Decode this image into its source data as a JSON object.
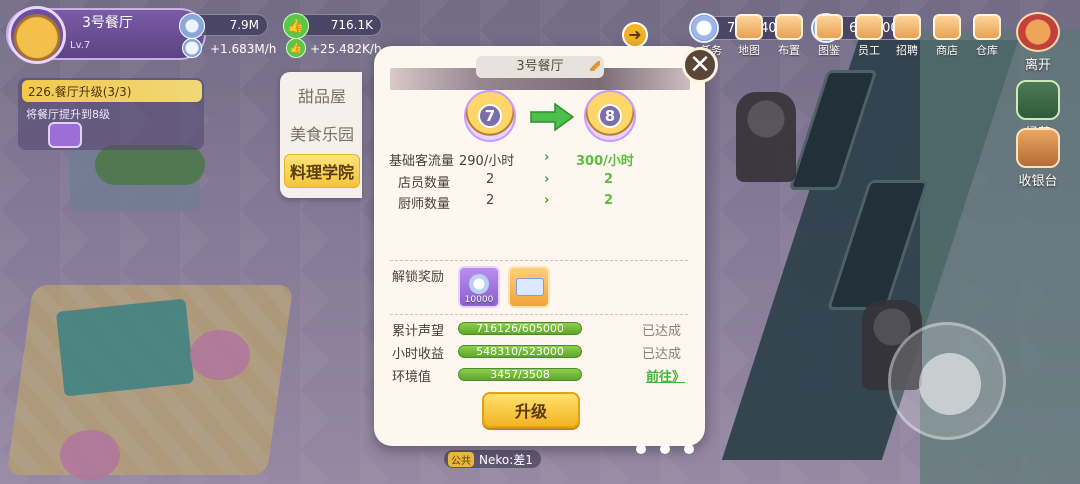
{
  "restaurant": {
    "name": "3号餐厅",
    "level": "Lv.7"
  },
  "resources": {
    "coins": "7.9M",
    "likes": "716.1K",
    "coin_rate": "+1.683M/h",
    "like_rate": "+25.482K/h"
  },
  "task": {
    "title": "226.餐厅升级(3/3)",
    "desc": "将餐厅提升到8级"
  },
  "currencies": [
    {
      "value": "7900402"
    },
    {
      "value": "659500"
    }
  ],
  "top_menu": [
    "任务",
    "地图",
    "布置",
    "图鉴",
    "员工",
    "招聘",
    "商店",
    "仓库"
  ],
  "side_buttons": {
    "leave": "离开",
    "manage": "经营",
    "cashier": "收银台"
  },
  "tabs": [
    {
      "label": "甜品屋",
      "active": false
    },
    {
      "label": "美食乐园",
      "active": false
    },
    {
      "label": "料理学院",
      "active": true
    }
  ],
  "dialog": {
    "title": "3号餐厅",
    "level_from": "7",
    "level_to": "8",
    "stats": [
      {
        "label": "基础客流量",
        "from": "290/小时",
        "to": "300/小时"
      },
      {
        "label": "店员数量",
        "from": "2",
        "to": "2"
      },
      {
        "label": "厨师数量",
        "from": "2",
        "to": "2"
      }
    ],
    "reward_label": "解锁奖励",
    "rewards": [
      {
        "icon": "silver-plate-icon",
        "count": "10000"
      },
      {
        "icon": "recipe-card-icon",
        "count": ""
      }
    ],
    "requirements": [
      {
        "label": "累计声望",
        "progress": "716126/605000",
        "status": "已达成",
        "is_link": false
      },
      {
        "label": "小时收益",
        "progress": "548310/523000",
        "status": "已达成",
        "is_link": false
      },
      {
        "label": "环境值",
        "progress": "3457/3508",
        "status": "前往》",
        "is_link": true
      }
    ],
    "upgrade_label": "升级"
  },
  "chat": {
    "channel": "公共",
    "message": "Neko:差1"
  },
  "colors": {
    "accent_yellow": "#f3c53b",
    "progress_green": "#5da62e",
    "link_green": "#43b43a",
    "panel_bg": "#fdf7ef"
  }
}
